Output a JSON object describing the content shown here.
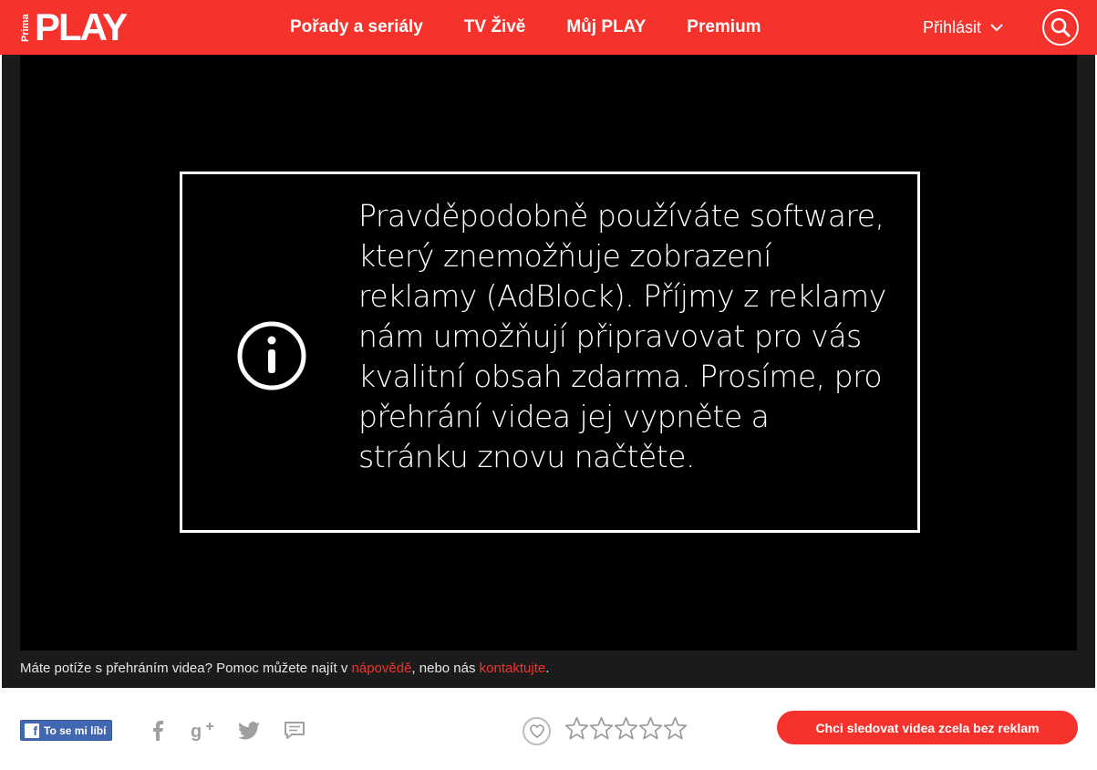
{
  "header": {
    "logo_small": "Prima",
    "logo_main": "PLAY",
    "nav": [
      "Pořady a seriály",
      "TV Živě",
      "Můj PLAY",
      "Premium"
    ],
    "login_label": "Přihlásit",
    "brand_color": "#f5322b"
  },
  "player": {
    "notice_text": "Pravděpodobně používáte software, který znemožňuje zobrazení reklamy (AdBlock). Příjmy z reklamy nám umožňují připravovat pro vás kvalitní obsah zdarma. Prosíme, pro přehrání videa jej vypněte a stránku znovu načtěte.",
    "notice_icon": "info-icon",
    "help_prefix": "Máte potíže s přehráním videa? Pomoc můžete najít v ",
    "help_link1": "nápovědě",
    "help_middle": ", nebo nás ",
    "help_link2": "kontaktujte",
    "help_suffix": "."
  },
  "bottom": {
    "fb_like_label": "To se mi líbí",
    "share_icons": [
      "facebook-icon",
      "google-plus-icon",
      "twitter-icon",
      "comment-icon"
    ],
    "favorite_icon": "heart-icon",
    "rating_stars": 5,
    "rating_value": 0,
    "cta_label": "Chci sledovat videa zcela bez reklam"
  }
}
